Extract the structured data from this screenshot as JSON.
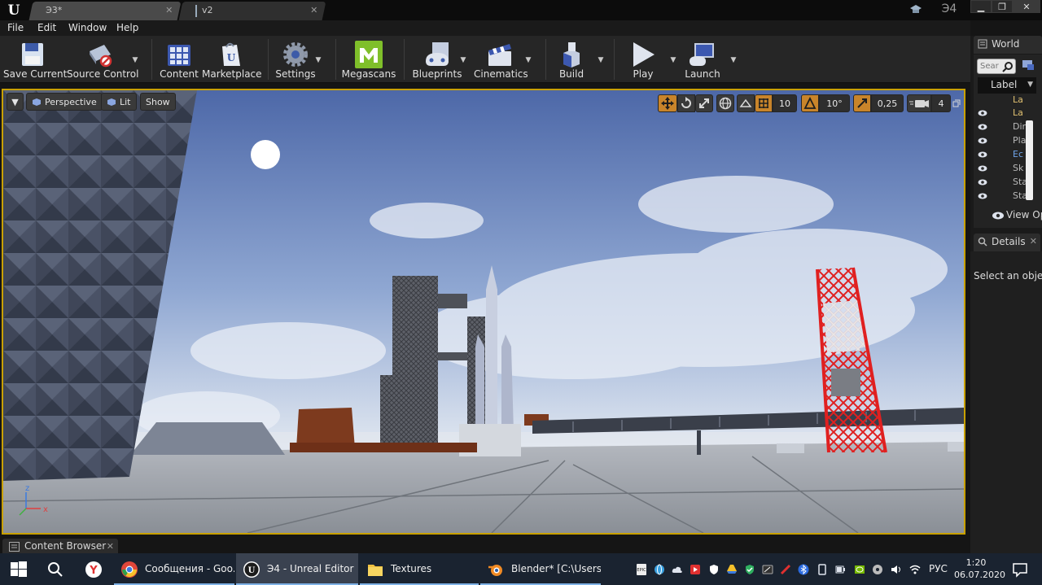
{
  "titlebar": {
    "tabs": [
      {
        "label": "Э3*"
      },
      {
        "label": "v2"
      }
    ],
    "project_name": "Э4"
  },
  "menu": [
    "File",
    "Edit",
    "Window",
    "Help"
  ],
  "toolbar": {
    "buttons": [
      {
        "label": "Save Current"
      },
      {
        "label": "Source Control"
      },
      {
        "label": "Content"
      },
      {
        "label": "Marketplace"
      },
      {
        "label": "Settings"
      },
      {
        "label": "Megascans"
      },
      {
        "label": "Blueprints"
      },
      {
        "label": "Cinematics"
      },
      {
        "label": "Build"
      },
      {
        "label": "Play"
      },
      {
        "label": "Launch"
      }
    ]
  },
  "viewport": {
    "buttons": {
      "perspective": "Perspective",
      "lit": "Lit",
      "show": "Show"
    },
    "grid_snap": "10",
    "rotation_snap": "10°",
    "scale_snap": "0,25",
    "camera_speed": "4",
    "axis": {
      "z": "z",
      "x": "x"
    },
    "accent_color": "#c8a000"
  },
  "world_outliner": {
    "tab_label": "World",
    "search_placeholder": "Sear",
    "label_column": "Label",
    "rows": [
      "La",
      "La",
      "Dir",
      "Pla",
      "Ec",
      "Sk",
      "Sta",
      "Sta"
    ],
    "view_options": "View Opt"
  },
  "details": {
    "tab_label": "Details",
    "empty_message": "Select an object"
  },
  "content_browser": {
    "tab_label": "Content Browser"
  },
  "taskbar": {
    "apps": [
      {
        "label": "Сообщения - Goo..."
      },
      {
        "label": "Э4 - Unreal Editor"
      },
      {
        "label": "Textures"
      },
      {
        "label": "Blender* [C:\\Users\\..."
      }
    ],
    "language": "РУС",
    "time": "1:20",
    "date": "06.07.2020"
  }
}
